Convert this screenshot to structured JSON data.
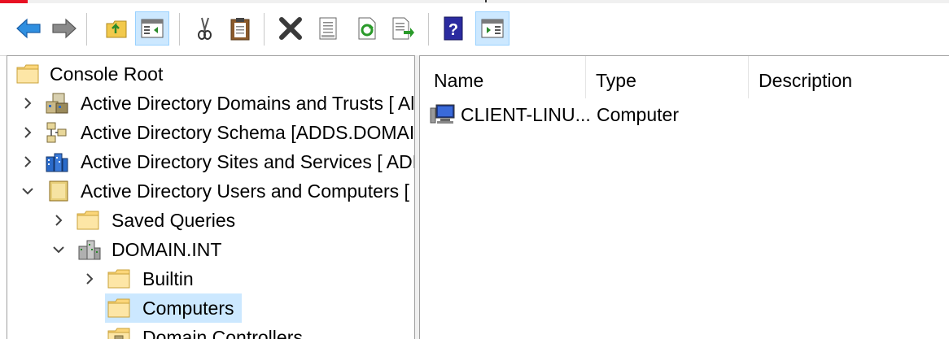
{
  "toolbar": {
    "buttons": [
      {
        "icon": "back-arrow-icon"
      },
      {
        "icon": "forward-arrow-icon"
      },
      {
        "icon": "up-folder-icon"
      },
      {
        "icon": "show-hide-console-tree-icon",
        "pressed": true
      },
      {
        "icon": "cut-icon"
      },
      {
        "icon": "paste-icon"
      },
      {
        "icon": "delete-icon"
      },
      {
        "icon": "properties-icon"
      },
      {
        "icon": "refresh-icon"
      },
      {
        "icon": "export-list-icon"
      },
      {
        "icon": "help-icon"
      },
      {
        "icon": "show-hide-action-pane-icon",
        "pressed": true
      }
    ]
  },
  "tree": {
    "root": "Console Root",
    "items": [
      {
        "label": "Active Directory Domains and Trusts [ Al",
        "icon": "domains-trusts-icon"
      },
      {
        "label": "Active Directory Schema [ADDS.DOMAIN",
        "icon": "schema-icon"
      },
      {
        "label": "Active Directory Sites and Services [ ADD",
        "icon": "sites-services-icon"
      },
      {
        "label": "Active Directory Users and Computers [",
        "icon": "users-computers-icon"
      },
      {
        "label": "Saved Queries",
        "icon": "folder-icon"
      },
      {
        "label": "DOMAIN.INT",
        "icon": "domain-icon"
      },
      {
        "label": "Builtin",
        "icon": "folder-icon"
      },
      {
        "label": "Computers",
        "icon": "folder-icon",
        "selected": true
      },
      {
        "label": "Domain Controllers",
        "icon": "ou-folder-icon"
      }
    ]
  },
  "list": {
    "columns": [
      "Name",
      "Type",
      "Description"
    ],
    "rows": [
      {
        "name": "CLIENT-LINU...",
        "type": "Computer",
        "description": "",
        "icon": "computer-icon"
      }
    ]
  },
  "colors": {
    "selection": "#cce8ff",
    "selection_border": "#99d1ff"
  }
}
